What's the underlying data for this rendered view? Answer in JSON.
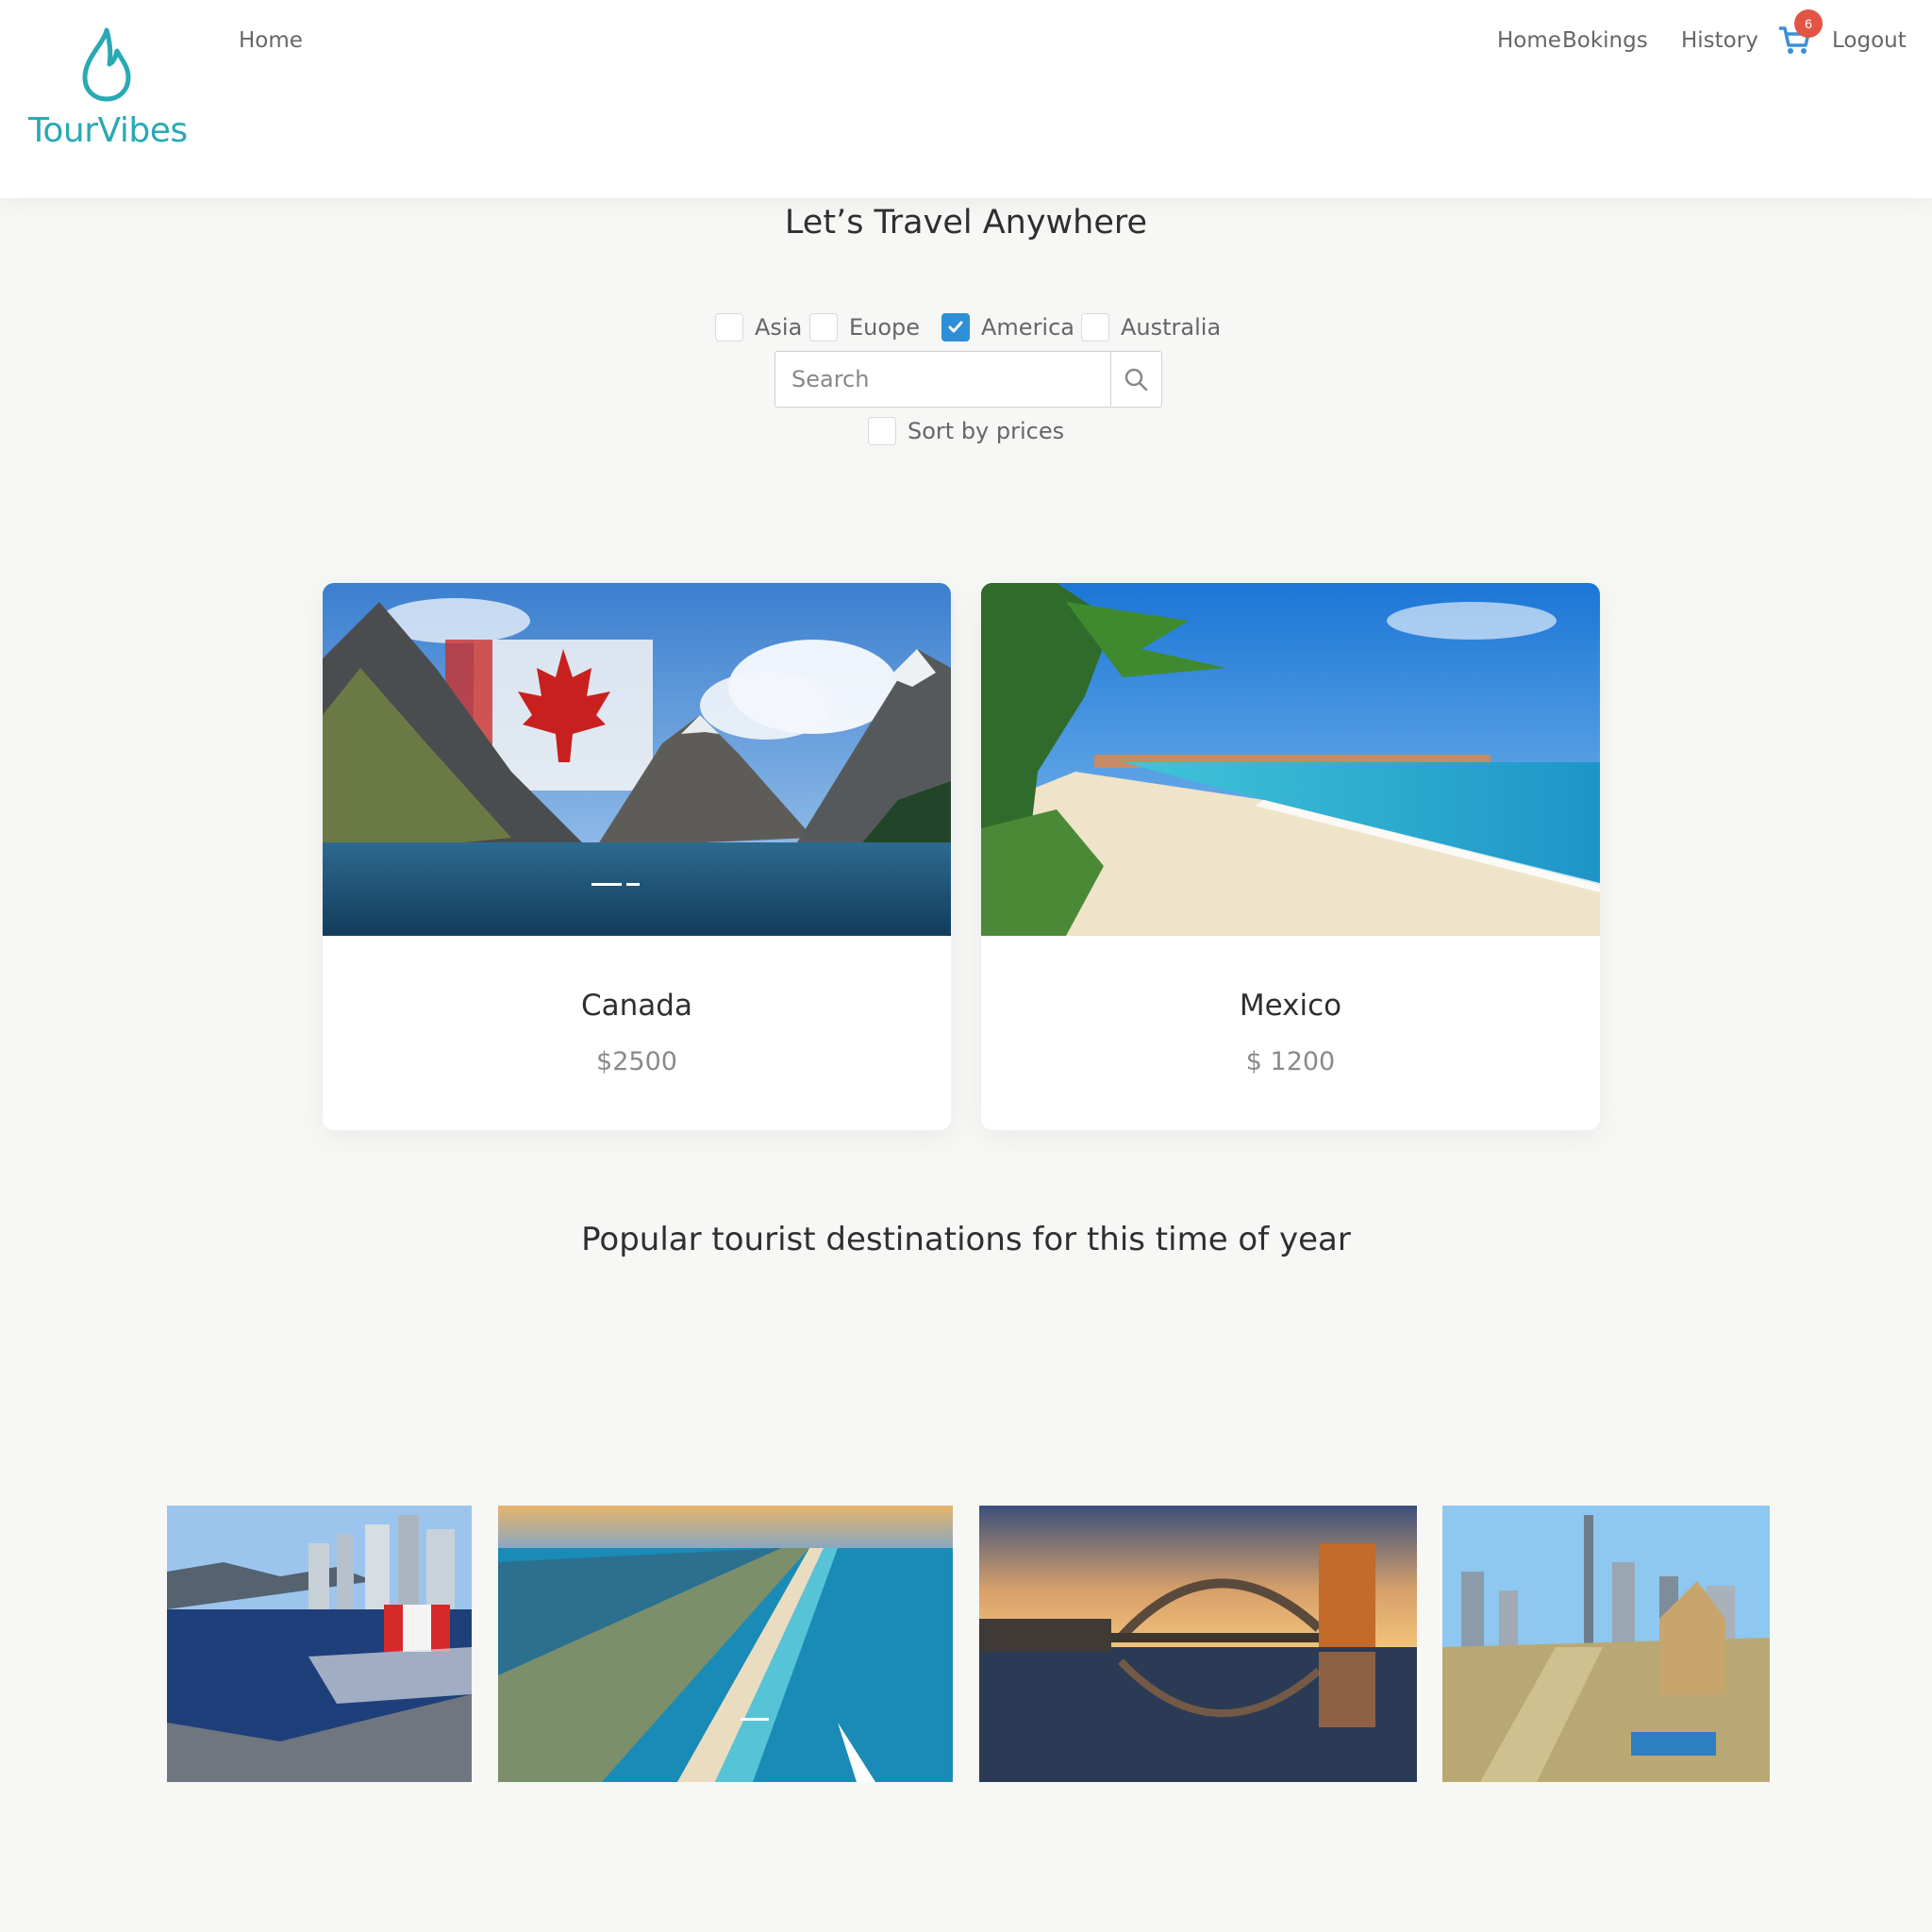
{
  "brand": {
    "name": "TourVibes",
    "color": "#2aa9b4"
  },
  "nav": {
    "left_link": "Home",
    "right_links": [
      "Home",
      "Bokings",
      "History"
    ],
    "cart_badge": "6",
    "logout": "Logout"
  },
  "main": {
    "title": "Let’s Travel Anywhere",
    "filters": [
      {
        "label": "Asia",
        "checked": false
      },
      {
        "label": "Euope",
        "checked": false
      },
      {
        "label": "America",
        "checked": true
      },
      {
        "label": "Australia",
        "checked": false
      }
    ],
    "search": {
      "placeholder": "Search"
    },
    "sort_label": "Sort by prices"
  },
  "cards": [
    {
      "title": "Canada",
      "price": "$2500",
      "image": "canada-mountain-lake-with-maple-leaf-flag"
    },
    {
      "title": "Mexico",
      "price": "$ 1200",
      "image": "mexico-tropical-beach-with-palm"
    }
  ],
  "popular": {
    "title": "Popular tourist destinations for this time of year",
    "items": [
      {
        "image": "vancouver-harbor-with-canadian-flag"
      },
      {
        "image": "aerial-coastline-beach"
      },
      {
        "image": "sydney-harbour-bridge-sunset"
      },
      {
        "image": "dubai-skyline"
      }
    ]
  },
  "colors": {
    "accent": "#2d8fd5",
    "badge": "#e25545",
    "background": "#f7f7f5"
  }
}
